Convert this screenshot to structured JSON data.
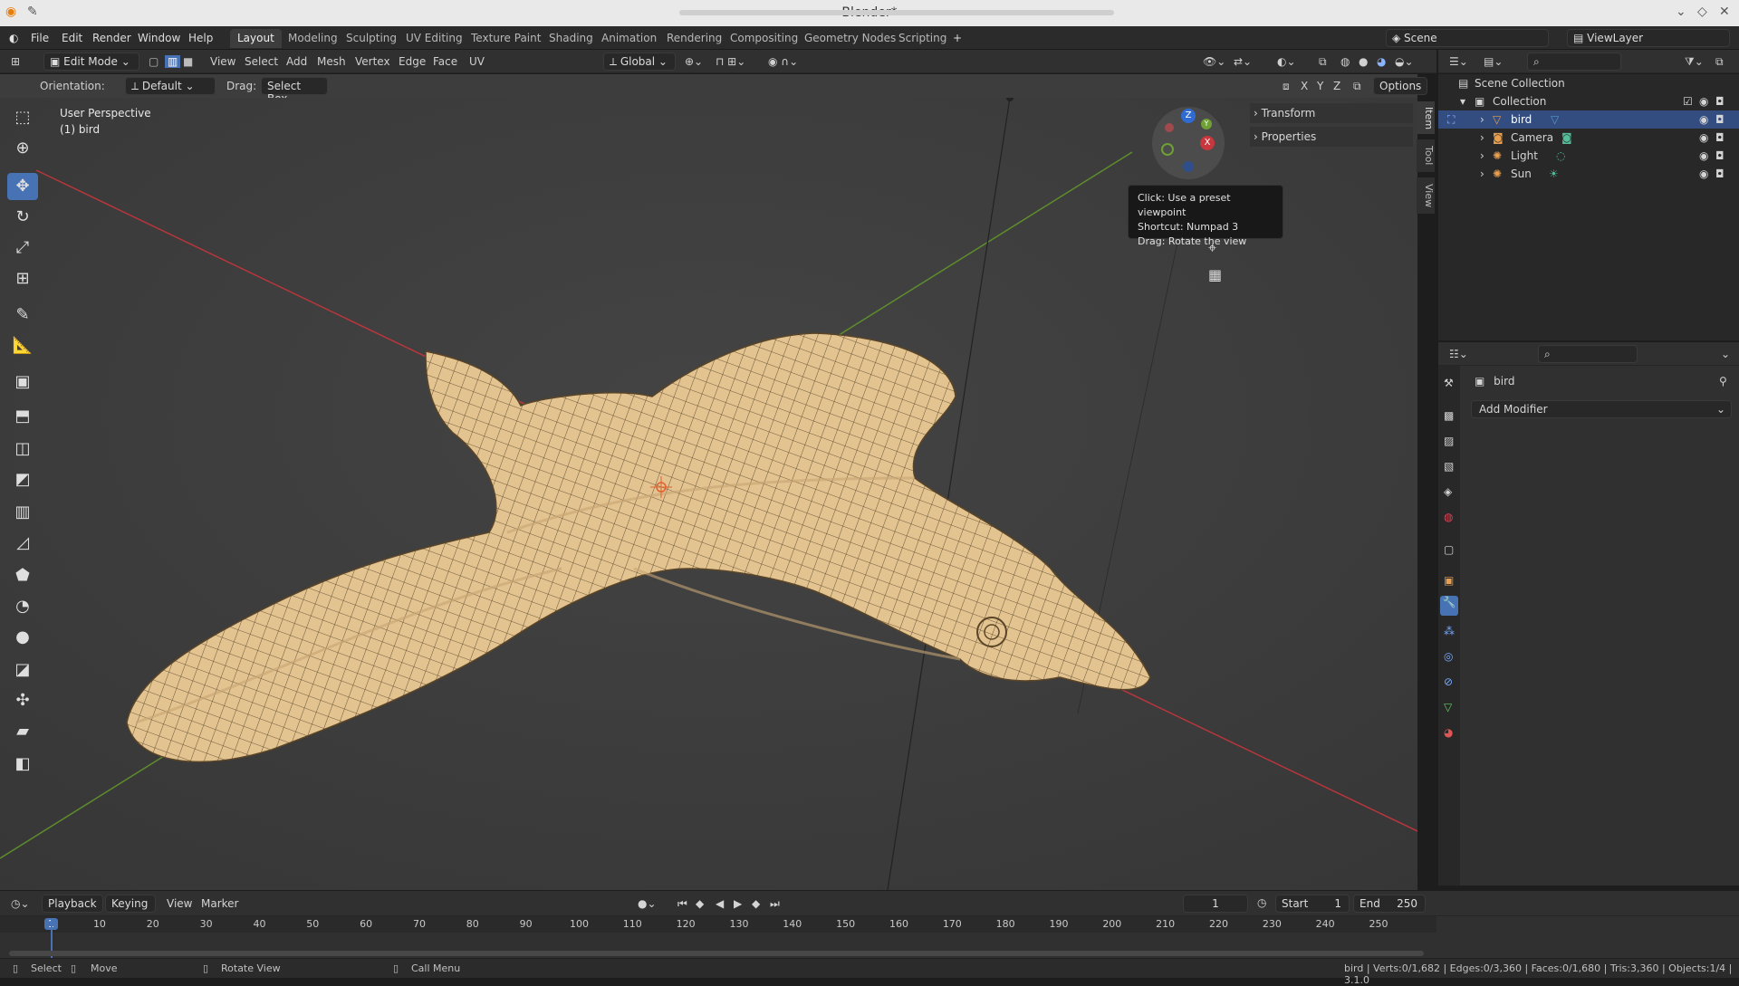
{
  "window": {
    "title": "Blender*"
  },
  "menu": [
    "File",
    "Edit",
    "Render",
    "Window",
    "Help"
  ],
  "workspaces": [
    "Layout",
    "Modeling",
    "Sculpting",
    "UV Editing",
    "Texture Paint",
    "Shading",
    "Animation",
    "Rendering",
    "Compositing",
    "Geometry Nodes",
    "Scripting"
  ],
  "scene": {
    "label": "Scene",
    "view_layer": "ViewLayer"
  },
  "header3d": {
    "mode": "Edit Mode",
    "menus": [
      "View",
      "Select",
      "Add",
      "Mesh",
      "Vertex",
      "Edge",
      "Face",
      "UV"
    ],
    "transform": "Global",
    "orientation_label": "Orientation:",
    "orientation_value": "Default",
    "drag_label": "Drag:",
    "drag_value": "Select Box",
    "axes": [
      "X",
      "Y",
      "Z"
    ],
    "options": "Options"
  },
  "viewport": {
    "perspective": "User Perspective",
    "object": "(1) bird",
    "tooltip": [
      "Click: Use a preset viewpoint",
      "Shortcut: Numpad 3",
      "Drag: Rotate the view"
    ],
    "npanel": [
      "Transform",
      "Properties"
    ],
    "ntabs": [
      "Item",
      "Tool",
      "View"
    ],
    "gizmo": {
      "x": "X",
      "y": "Y",
      "z": "Z"
    }
  },
  "outliner": {
    "root": "Scene Collection",
    "collection": "Collection",
    "items": [
      "bird",
      "Camera",
      "Light",
      "Sun"
    ]
  },
  "properties": {
    "object": "bird",
    "add_modifier": "Add Modifier"
  },
  "timeline": {
    "menus": [
      "Playback",
      "Keying",
      "View",
      "Marker"
    ],
    "current_frame": "1",
    "start_label": "Start",
    "start": "1",
    "end_label": "End",
    "end": "250",
    "ticks": [
      "1",
      "10",
      "20",
      "30",
      "40",
      "50",
      "60",
      "70",
      "80",
      "90",
      "100",
      "110",
      "120",
      "130",
      "140",
      "150",
      "160",
      "170",
      "180",
      "190",
      "200",
      "210",
      "220",
      "230",
      "240",
      "250"
    ]
  },
  "status": {
    "select": "Select",
    "move": "Move",
    "rotate": "Rotate View",
    "menu": "Call Menu",
    "stats": "bird | Verts:0/1,682 | Edges:0/3,360 | Faces:0/1,680 | Tris:3,360 | Objects:1/4 | 3.1.0"
  },
  "colors": {
    "accent": "#4772b3",
    "mesh": "#e3c38f",
    "x_axis": "#c9373e",
    "y_axis": "#6fa033"
  }
}
